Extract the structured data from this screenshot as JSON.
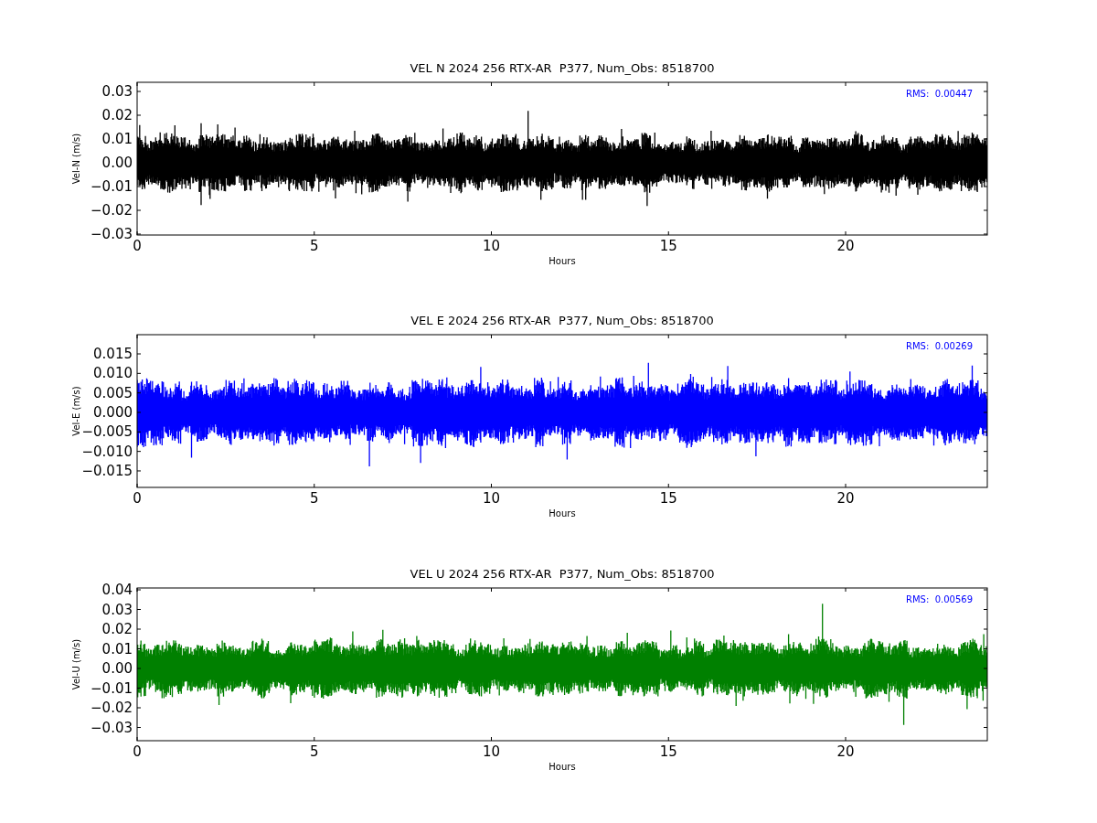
{
  "figure": {
    "panels": [
      {
        "title": "VEL N 2024 256 RTX-AR  P377, Num_Obs: 8518700",
        "ylabel": "Vel-N (m/s)",
        "xlabel": "Hours",
        "rms": "RMS:  0.00447",
        "color": "#000000",
        "xticks": [
          "0",
          "5",
          "10",
          "15",
          "20"
        ],
        "yticks": [
          "0.03",
          "0.02",
          "0.01",
          "0.00",
          "−0.01",
          "−0.02",
          "−0.03"
        ]
      },
      {
        "title": "VEL E 2024 256 RTX-AR  P377, Num_Obs: 8518700",
        "ylabel": "Vel-E (m/s)",
        "xlabel": "Hours",
        "rms": "RMS:  0.00269",
        "color": "#0000ff",
        "xticks": [
          "0",
          "5",
          "10",
          "15",
          "20"
        ],
        "yticks": [
          "0.015",
          "0.010",
          "0.005",
          "0.000",
          "−0.005",
          "−0.010",
          "−0.015"
        ]
      },
      {
        "title": "VEL U 2024 256 RTX-AR  P377, Num_Obs: 8518700",
        "ylabel": "Vel-U (m/s)",
        "xlabel": "Hours",
        "rms": "RMS:  0.00569",
        "color": "#008000",
        "xticks": [
          "0",
          "5",
          "10",
          "15",
          "20"
        ],
        "yticks": [
          "0.04",
          "0.03",
          "0.02",
          "0.01",
          "0.00",
          "−0.01",
          "−0.02",
          "−0.03"
        ]
      }
    ]
  }
}
